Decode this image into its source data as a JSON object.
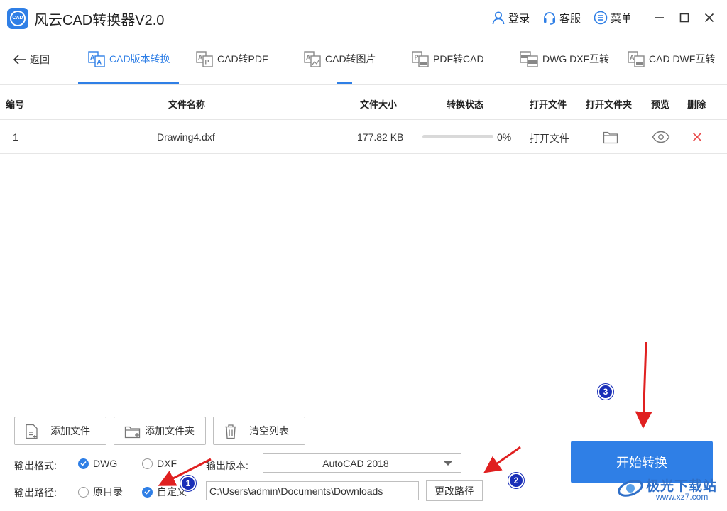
{
  "app": {
    "title": "风云CAD转换器V2.0",
    "logo_text": "CAD",
    "login_label": "登录",
    "service_label": "客服",
    "menu_label": "菜单"
  },
  "nav": {
    "back_label": "返回",
    "tabs": [
      {
        "label": "CAD版本转换",
        "active": true
      },
      {
        "label": "CAD转PDF"
      },
      {
        "label": "CAD转图片"
      },
      {
        "label": "PDF转CAD"
      },
      {
        "label": "DWG DXF互转"
      },
      {
        "label": "CAD DWF互转"
      }
    ]
  },
  "table": {
    "headers": [
      "编号",
      "文件名称",
      "文件大小",
      "转换状态",
      "打开文件",
      "打开文件夹",
      "预览",
      "删除"
    ],
    "rows": [
      {
        "index": "1",
        "name": "Drawing4.dxf",
        "size": "177.82 KB",
        "progress": 0,
        "progress_label": "0%",
        "open_label": "打开文件"
      }
    ]
  },
  "bottom": {
    "add_file": "添加文件",
    "add_folder": "添加文件夹",
    "clear_list": "清空列表",
    "format_label": "输出格式:",
    "format_options": [
      "DWG",
      "DXF"
    ],
    "format_selected": "DWG",
    "version_label": "输出版本:",
    "version_value": "AutoCAD 2018",
    "path_label": "输出路径:",
    "path_options": [
      "原目录",
      "自定义"
    ],
    "path_selected": "自定义",
    "path_value": "C:\\Users\\admin\\Documents\\Downloads",
    "change_path": "更改路径",
    "start_label": "开始转换"
  },
  "annotations": {
    "badges": [
      "1",
      "2",
      "3"
    ],
    "arrow_color": "#e02020"
  },
  "watermark": {
    "title": "极光下载站",
    "url": "www.xz7.com"
  },
  "colors": {
    "accent": "#2f7fe6",
    "delete": "#e84a4a"
  }
}
